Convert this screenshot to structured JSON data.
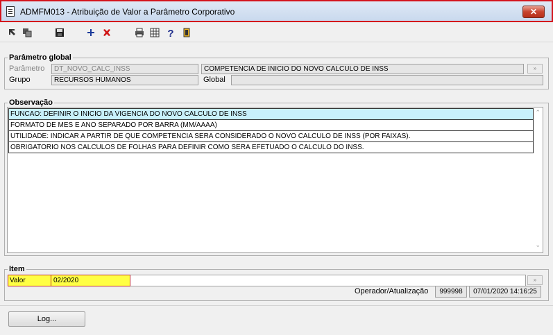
{
  "window": {
    "title": "ADMFM013 - Atribuição de Valor a Parâmetro Corporativo",
    "close_label": "✕"
  },
  "toolbar": {
    "icons": [
      "arrow-in-icon",
      "copy-icon",
      "save-icon",
      "add-icon",
      "delete-icon",
      "print-icon",
      "grid-icon",
      "help-icon",
      "exit-icon"
    ]
  },
  "parametro_global": {
    "group_label": "Parâmetro global",
    "parametro_label": "Parâmetro",
    "parametro_value": "DT_NOVO_CALC_INSS",
    "descricao_value": "COMPETENCIA DE INICIO DO NOVO CALCULO DE INSS",
    "grupo_label": "Grupo",
    "grupo_value": "RECURSOS HUMANOS",
    "global_label": "Global",
    "global_value": "",
    "lookup_label": "»"
  },
  "observacao": {
    "group_label": "Observação",
    "lines": [
      "FUNCAO: DEFINIR O INICIO DA VIGENCIA DO NOVO CALCULO DE INSS",
      "FORMATO DE MES E ANO SEPARADO POR BARRA (MM/AAAA)",
      "UTILIDADE: INDICAR A PARTIR DE QUE COMPETENCIA SERA CONSIDERADO O NOVO CALCULO DE INSS (POR FAIXAS).",
      "OBRIGATORIO NOS CALCULOS DE FOLHAS PARA DEFINIR COMO SERA EFETUADO O CALCULO DO INSS."
    ],
    "scroll_up": "⌃",
    "scroll_down": "⌄"
  },
  "item": {
    "group_label": "Item",
    "valor_label": "Valor",
    "valor_value": "02/2020",
    "lookup_label": "»",
    "operador_label": "Operador/Atualização",
    "operador_value": "999998",
    "atualizacao_value": "07/01/2020 14:16:25"
  },
  "footer": {
    "log_label": "Log..."
  },
  "colors": {
    "title_border": "#d4141c",
    "highlight_yellow": "#ffff44",
    "selected_row": "#c8f0fb"
  }
}
